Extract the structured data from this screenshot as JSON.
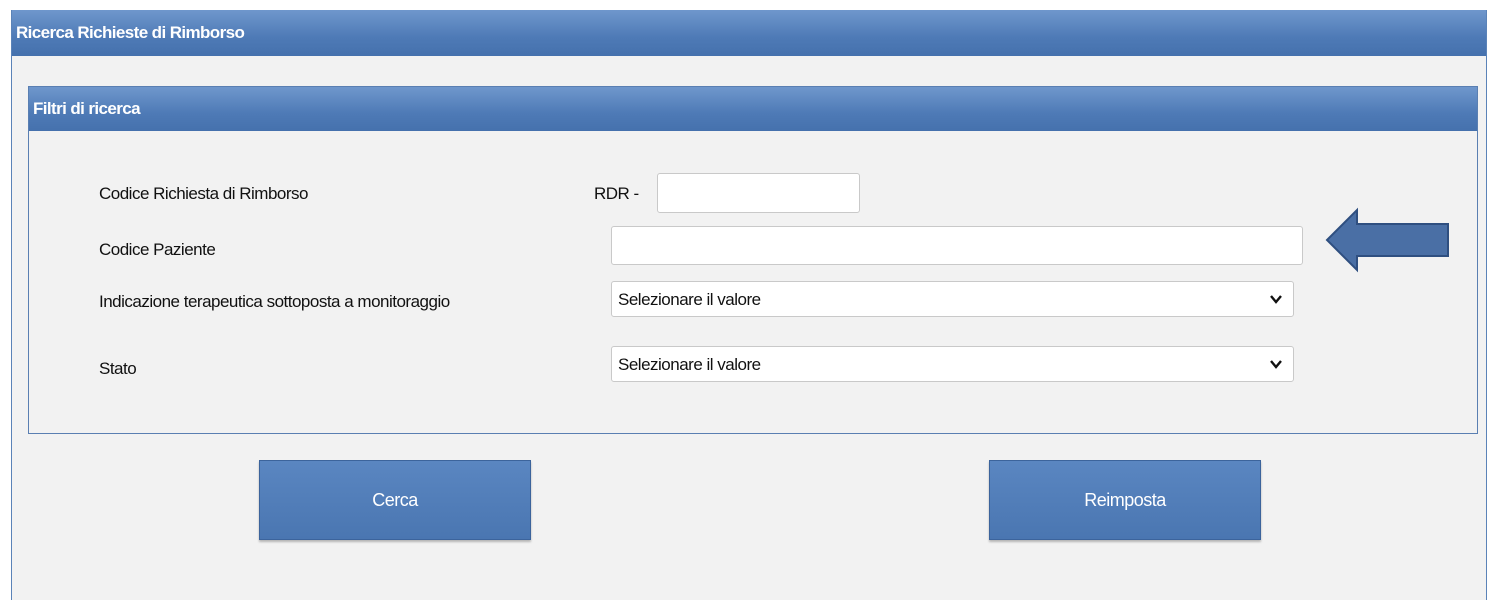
{
  "window": {
    "title": "Ricerca Richieste di Rimborso"
  },
  "filters": {
    "title": "Filtri di ricerca",
    "codice_rdr": {
      "label": "Codice Richiesta di Rimborso",
      "prefix": "RDR -",
      "value": ""
    },
    "codice_paziente": {
      "label": "Codice Paziente",
      "value": ""
    },
    "indicazione": {
      "label": "Indicazione terapeutica sottoposta a monitoraggio",
      "selected": "Selezionare il valore"
    },
    "stato": {
      "label": "Stato",
      "selected": "Selezionare il valore"
    }
  },
  "actions": {
    "search_label": "Cerca",
    "reset_label": "Reimposta"
  },
  "annotation": {
    "icon": "left-arrow-icon",
    "color": "#4a6fa5"
  },
  "colors": {
    "header_blue": "#4e7ab6",
    "button_blue": "#4a76b1",
    "background": "#f2f2f2"
  }
}
